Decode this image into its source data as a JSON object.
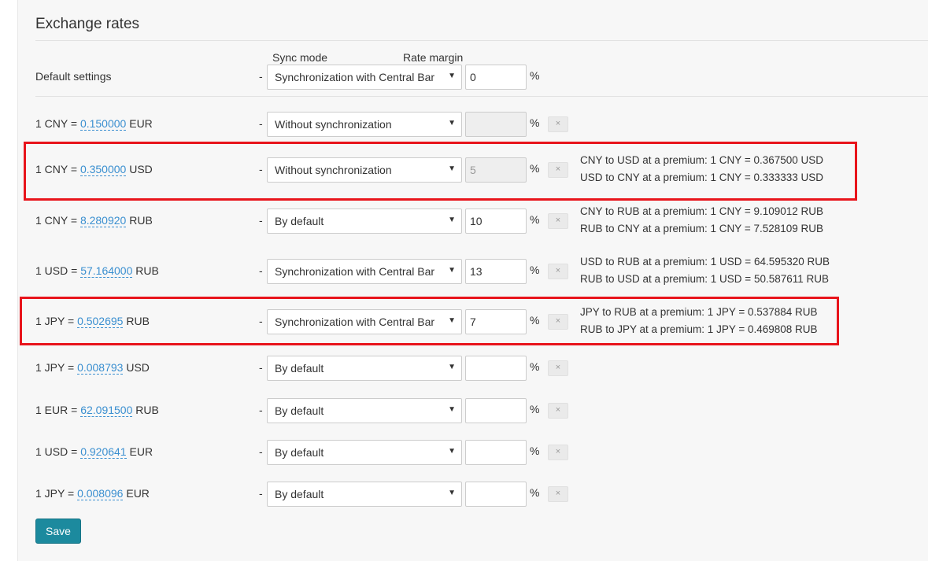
{
  "page_title": "Exchange rates",
  "columns": {
    "sync_mode": "Sync mode",
    "rate_margin": "Rate margin"
  },
  "default_settings": {
    "label": "Default settings",
    "dash": "-",
    "sync_mode": "Synchronization with Central Bar",
    "margin": "0",
    "percent": "%"
  },
  "rows": [
    {
      "prefix": "1 CNY = ",
      "value": "0.150000",
      "suffix": " EUR",
      "dash": "-",
      "sync_mode": "Without synchronization",
      "margin": "",
      "percent": "%",
      "delete": "×",
      "premium": []
    },
    {
      "prefix": "1 CNY = ",
      "value": "0.350000",
      "suffix": " USD",
      "dash": "-",
      "sync_mode": "Without synchronization",
      "margin": "5",
      "percent": "%",
      "delete": "×",
      "premium": [
        "CNY to USD at a premium: 1 CNY = 0.367500 USD",
        "USD to CNY at a premium: 1 CNY = 0.333333 USD"
      ]
    },
    {
      "prefix": "1 CNY = ",
      "value": "8.280920",
      "suffix": " RUB",
      "dash": "-",
      "sync_mode": "By default",
      "margin": "10",
      "percent": "%",
      "delete": "×",
      "premium": [
        "CNY to RUB at a premium: 1 CNY = 9.109012 RUB",
        "RUB to CNY at a premium: 1 CNY = 7.528109 RUB"
      ]
    },
    {
      "prefix": "1 USD = ",
      "value": "57.164000",
      "suffix": " RUB",
      "dash": "-",
      "sync_mode": "Synchronization with Central Bar",
      "margin": "13",
      "percent": "%",
      "delete": "×",
      "premium": [
        "USD to RUB at a premium: 1 USD = 64.595320 RUB",
        "RUB to USD at a premium: 1 USD = 50.587611 RUB"
      ]
    },
    {
      "prefix": "1 JPY = ",
      "value": "0.502695",
      "suffix": " RUB",
      "dash": "-",
      "sync_mode": "Synchronization with Central Bar",
      "margin": "7",
      "percent": "%",
      "delete": "×",
      "premium": [
        "JPY to RUB at a premium: 1 JPY = 0.537884 RUB",
        "RUB to JPY at a premium: 1 JPY = 0.469808 RUB"
      ]
    },
    {
      "prefix": "1 JPY = ",
      "value": "0.008793",
      "suffix": " USD",
      "dash": "-",
      "sync_mode": "By default",
      "margin": "",
      "percent": "%",
      "delete": "×",
      "premium": []
    },
    {
      "prefix": "1 EUR = ",
      "value": "62.091500",
      "suffix": " RUB",
      "dash": "-",
      "sync_mode": "By default",
      "margin": "",
      "percent": "%",
      "delete": "×",
      "premium": []
    },
    {
      "prefix": "1 USD = ",
      "value": "0.920641",
      "suffix": " EUR",
      "dash": "-",
      "sync_mode": "By default",
      "margin": "",
      "percent": "%",
      "delete": "×",
      "premium": []
    },
    {
      "prefix": "1 JPY = ",
      "value": "0.008096",
      "suffix": " EUR",
      "dash": "-",
      "sync_mode": "By default",
      "margin": "",
      "percent": "%",
      "delete": "×",
      "premium": []
    }
  ],
  "save_label": "Save",
  "highlight_color": "#e8141b",
  "accent_color": "#1c8a9e",
  "link_color": "#3a8fd0"
}
